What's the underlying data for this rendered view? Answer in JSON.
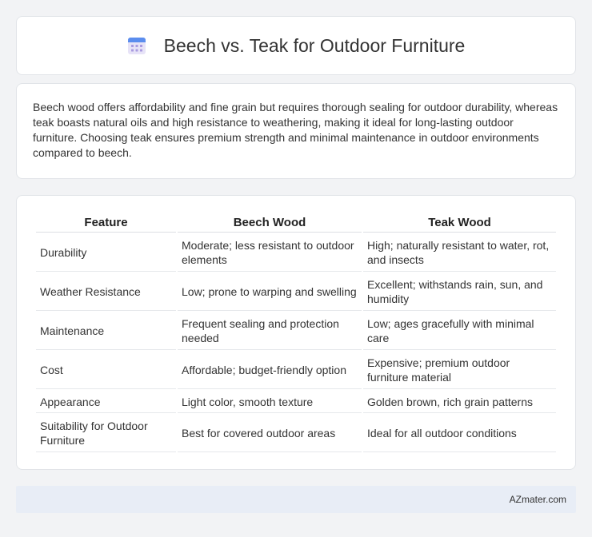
{
  "header": {
    "title": "Beech vs. Teak for Outdoor Furniture",
    "icon": "calendar-icon"
  },
  "summary": {
    "text": "Beech wood offers affordability and fine grain but requires thorough sealing for outdoor durability, whereas teak boasts natural oils and high resistance to weathering, making it ideal for long-lasting outdoor furniture. Choosing teak ensures premium strength and minimal maintenance in outdoor environments compared to beech."
  },
  "table": {
    "headers": [
      "Feature",
      "Beech Wood",
      "Teak Wood"
    ],
    "rows": [
      [
        "Durability",
        "Moderate; less resistant to outdoor elements",
        "High; naturally resistant to water, rot, and insects"
      ],
      [
        "Weather Resistance",
        "Low; prone to warping and swelling",
        "Excellent; withstands rain, sun, and humidity"
      ],
      [
        "Maintenance",
        "Frequent sealing and protection needed",
        "Low; ages gracefully with minimal care"
      ],
      [
        "Cost",
        "Affordable; budget-friendly option",
        "Expensive; premium outdoor furniture material"
      ],
      [
        "Appearance",
        "Light color, smooth texture",
        "Golden brown, rich grain patterns"
      ],
      [
        "Suitability for Outdoor Furniture",
        "Best for covered outdoor areas",
        "Ideal for all outdoor conditions"
      ]
    ]
  },
  "footer": {
    "brand": "AZmater.com"
  }
}
